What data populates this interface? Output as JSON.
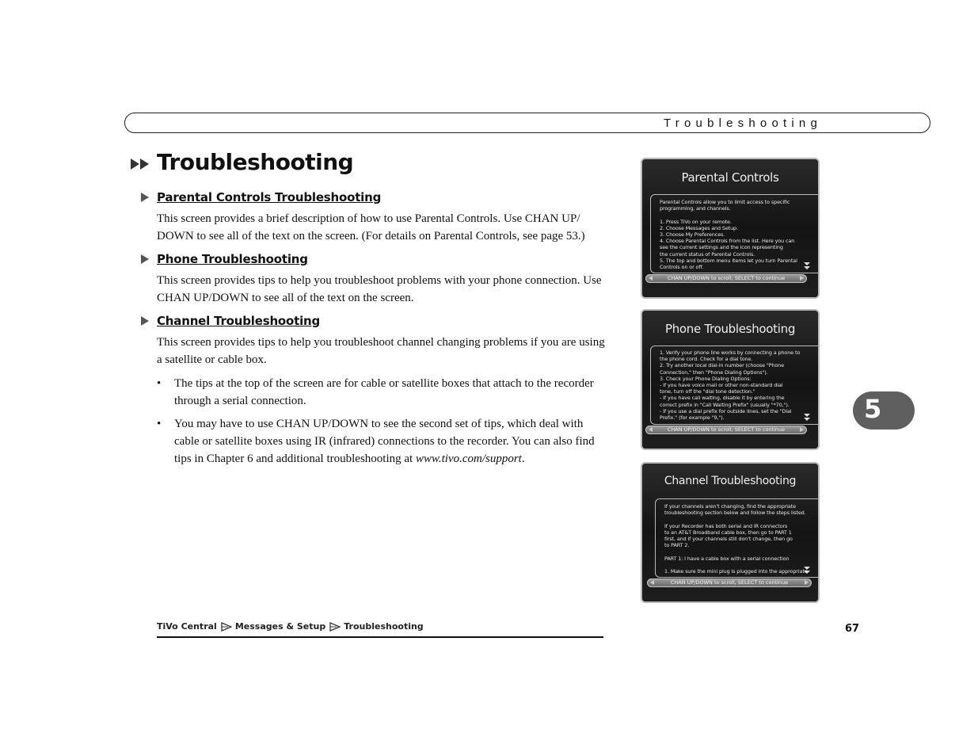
{
  "header": {
    "running_title": "Troubleshooting"
  },
  "page": {
    "title": "Troubleshooting",
    "title_icon": "fast-forward-icon"
  },
  "sections": [
    {
      "title": "Parental Controls Troubleshooting",
      "body": "This screen provides a brief description of how to use Parental Controls. Use CHAN UP/ DOWN to see all of the text on the screen. (For details on Parental Controls, see page 53.)"
    },
    {
      "title": "Phone Troubleshooting",
      "body": "This screen provides tips to help you troubleshoot problems with your phone connection. Use CHAN UP/DOWN to see all of the text on the screen."
    },
    {
      "title": "Channel Troubleshooting",
      "body": "This screen provides tips to help you troubleshoot channel changing problems if you are using a satellite or cable box.",
      "bullets": [
        "The tips at the top of the screen are for cable or satellite boxes that attach to the recorder through a serial connection.",
        "You may have to use CHAN UP/DOWN to see the second set of tips, which deal with cable or satellite boxes using IR (infrared) connections to the recorder. You can also find tips in Chapter 6 and additional troubleshooting at"
      ],
      "bullet_url": "www.tivo.com/support",
      "bullet_end": "."
    }
  ],
  "bullet_glyph": "•",
  "screens": [
    {
      "title": "Parental Controls",
      "text": "Parental Controls allow you to limit access to specific\nprogramming, and channels.\n\n1. Press TiVo on your remote.\n2. Choose Messages and Setup.\n3. Choose My Preferences.\n4. Choose Parental Controls from the list. Here you can\n    see the current settings and the icon representing\n    the current status of Parental Controls.\n5. The top and bottom menu items let you turn Parental\n    Controls on or off.",
      "footer": "CHAN UP/DOWN to scroll, SELECT to continue"
    },
    {
      "title": "Phone Troubleshooting",
      "text": "1. Verify your phone line works by connecting a phone to\n    the phone cord.  Check for a dial tone.\n2. Try another local dial-in number (choose \"Phone\n    Connection,\" then \"Phone Dialing Options\").\n3. Check your Phone Dialing Options:\n  - If you have voice mail or other non-standard dial\n    tone, turn off the \"dial tone detection.\"\n  - If you have call waiting, disable it by entering the\n    correct prefix in \"Call Waiting Prefix\" (usually \"*70,\").\n  - If you use a dial prefix for outside lines, set the \"Dial\n    Prefix.\" (for example \"9,\").",
      "footer": "CHAN UP/DOWN to scroll, SELECT to continue"
    },
    {
      "title": "Channel Troubleshooting",
      "text": "If your channels aren't changing, find the appropriate\ntroubleshooting section below and follow the steps listed.\n\nIf your Recorder has both serial and IR connectors\nto an AT&T Broadband cable box, then go to PART 1\nfirst, and if your channels still don't change, then go\nto PART 2.\n\nPART 1:  I have a cable box with a serial connection\n\n1. Make sure the mini plug is plugged into the appropriate",
      "footer": "CHAN UP/DOWN to scroll, SELECT to continue"
    }
  ],
  "chapter": {
    "number": "5"
  },
  "footer": {
    "breadcrumb": [
      "TiVo Central",
      "Messages & Setup",
      "Troubleshooting"
    ],
    "page_number": "67"
  }
}
